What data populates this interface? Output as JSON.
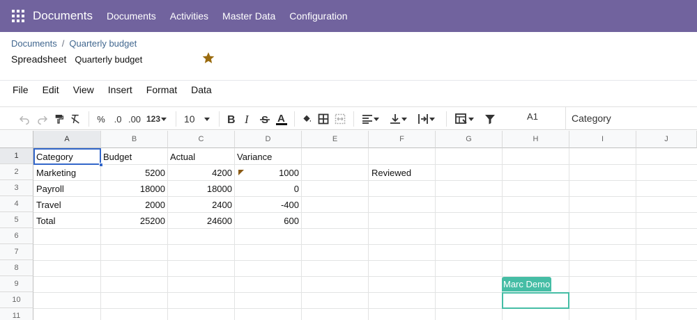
{
  "navbar": {
    "app_name": "Documents",
    "items": [
      "Documents",
      "Activities",
      "Master Data",
      "Configuration"
    ],
    "color": "#71639e"
  },
  "breadcrumb": {
    "parent": "Documents",
    "separator": "/",
    "current": "Quarterly budget"
  },
  "document": {
    "type_label": "Spreadsheet",
    "name": "Quarterly budget",
    "favorite": true
  },
  "menubar": [
    "File",
    "Edit",
    "View",
    "Insert",
    "Format",
    "Data"
  ],
  "toolbar": {
    "percent": "%",
    "decrease_decimal": ".0",
    "increase_decimal": ".00",
    "more_formats": "123",
    "font_size": "10",
    "cell_ref": "A1",
    "formula": "Category",
    "icons": [
      "undo-icon",
      "redo-icon",
      "paint-format-icon",
      "clear-format-icon",
      "bold-icon",
      "italic-icon",
      "strikethrough-icon",
      "text-color-icon",
      "fill-color-icon",
      "borders-icon",
      "merge-cells-icon",
      "horizontal-align-icon",
      "vertical-align-icon",
      "wrapping-icon",
      "conditional-format-icon",
      "filter-icon"
    ]
  },
  "sheet": {
    "columns": [
      "A",
      "B",
      "C",
      "D",
      "E",
      "F",
      "G",
      "H",
      "I",
      "J"
    ],
    "rows": [
      "1",
      "2",
      "3",
      "4",
      "5",
      "6",
      "7",
      "8",
      "9",
      "10",
      "11"
    ],
    "cells": {
      "A1": "Category",
      "B1": "Budget",
      "C1": "Actual",
      "D1": "Variance",
      "A2": "Marketing",
      "B2": "5200",
      "C2": "4200",
      "D2": "1000",
      "F2": "Reviewed",
      "A3": "Payroll",
      "B3": "18000",
      "C3": "18000",
      "D3": "0",
      "A4": "Travel",
      "B4": "2000",
      "C4": "2400",
      "D4": "-400",
      "A5": "Total",
      "B5": "25200",
      "C5": "24600",
      "D5": "600"
    },
    "selected_cell": "A1",
    "collaborator": {
      "name": "Marc Demo",
      "cell": "H10",
      "color": "#45bda5"
    }
  }
}
